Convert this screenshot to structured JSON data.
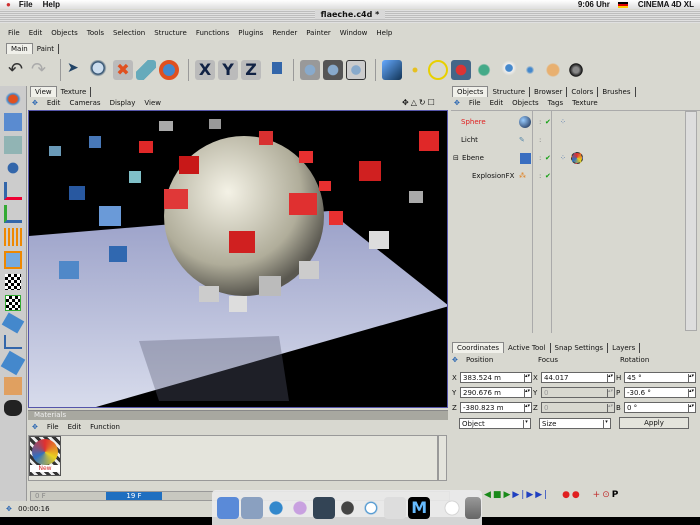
{
  "mac_menubar": {
    "items": [
      "File",
      "Help"
    ],
    "clock": "9:06 Uhr",
    "app_name": "CINEMA 4D XL"
  },
  "window": {
    "title": "flaeche.c4d *"
  },
  "main_menu": [
    "File",
    "Edit",
    "Objects",
    "Tools",
    "Selection",
    "Structure",
    "Functions",
    "Plugins",
    "Render",
    "Painter",
    "Window",
    "Help"
  ],
  "layout_tabs": [
    "Main",
    "Paint"
  ],
  "toolbar": {
    "axis": [
      "X",
      "Y",
      "Z"
    ]
  },
  "viewport": {
    "tabs": [
      "View",
      "Texture"
    ],
    "menu": [
      "Edit",
      "Cameras",
      "Display",
      "View"
    ]
  },
  "object_manager": {
    "tabs": [
      "Objects",
      "Structure",
      "Browser",
      "Colors",
      "Brushes"
    ],
    "menu": [
      "File",
      "Edit",
      "Objects",
      "Tags",
      "Texture"
    ],
    "objects": [
      {
        "name": "Sphere",
        "selected": true
      },
      {
        "name": "Licht"
      },
      {
        "name": "Ebene"
      },
      {
        "name": "ExplosionFX"
      }
    ]
  },
  "coordinates": {
    "tabs": [
      "Coordinates",
      "Active Tool",
      "Snap Settings",
      "Layers"
    ],
    "headers": [
      "Position",
      "Focus",
      "Rotation"
    ],
    "position": {
      "X": "383.524 m",
      "Y": "290.676 m",
      "Z": "-380.823 m"
    },
    "focus": {
      "X": "44.017",
      "Y": "0",
      "Z": "0"
    },
    "rotation": {
      "H": "45 °",
      "P": "-30.6 °",
      "B": "0 °"
    },
    "labels_pos": [
      "X",
      "Y",
      "Z"
    ],
    "labels_rot": [
      "H",
      "P",
      "B"
    ],
    "mode_select": "Object",
    "size_select": "Size",
    "apply_label": "Apply"
  },
  "materials": {
    "title": "Materials",
    "menu": [
      "File",
      "Edit",
      "Function"
    ],
    "items": [
      {
        "name": "New"
      }
    ]
  },
  "timeline": {
    "start": "0 F",
    "current": "19 F",
    "progress": 0.35
  },
  "status": {
    "time": "00:00:16"
  },
  "colors": {
    "accent": "#1f6fc0",
    "selected_text": "#e02020",
    "check": "#10a010"
  }
}
